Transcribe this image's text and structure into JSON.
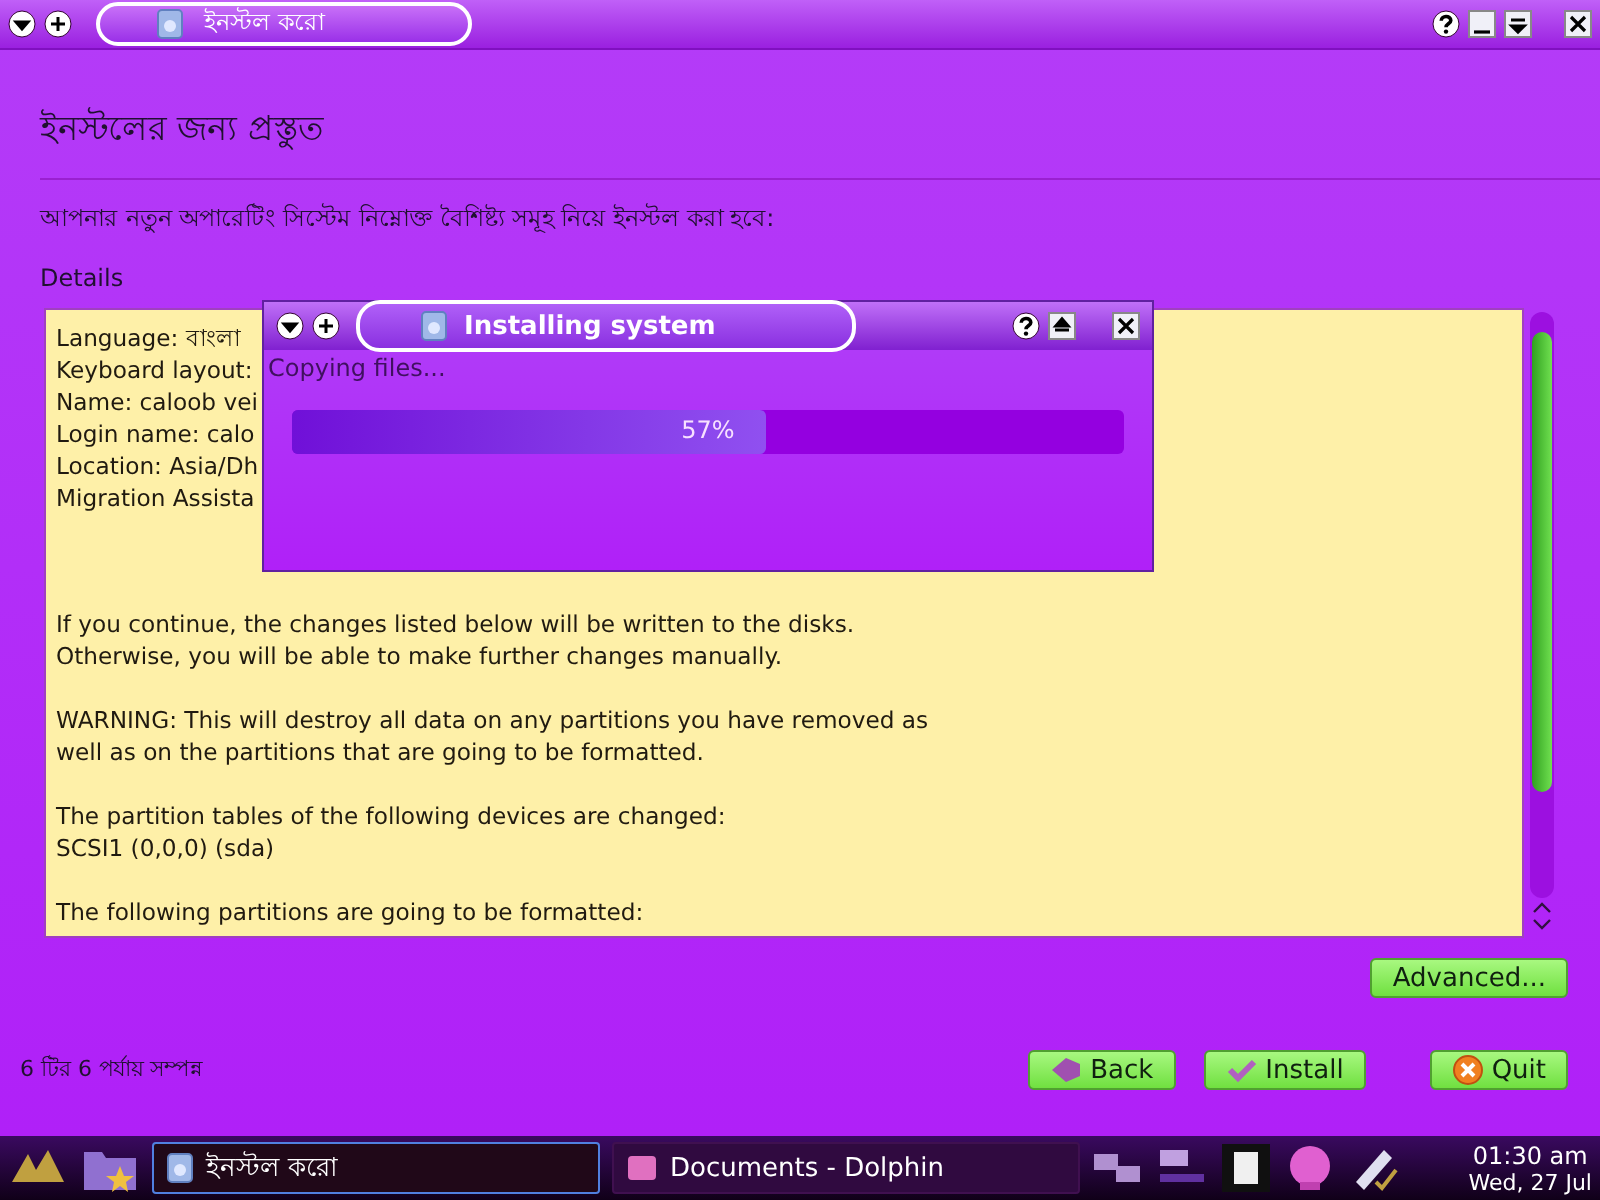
{
  "window": {
    "title": "ইনস্টল করো"
  },
  "heading": "ইনস্টলের জন্য প্রস্তুত",
  "intro": "আপনার নতুন অপারেটিং সিস্টেম নিম্নোক্ত বৈশিষ্ট্য সমূহ নিয়ে ইনস্টল করা হবে:",
  "details_label": "Details",
  "details": [
    {
      "lines": [
        "Language: বাংলা",
        "Keyboard layout:",
        "Name: caloob vei",
        "Login name: calo",
        "Location: Asia/Dh",
        "Migration Assista"
      ]
    },
    {
      "lines": [
        "If you continue, the changes listed below will be written to the disks.",
        "Otherwise, you will be able to make further changes manually."
      ]
    },
    {
      "lines": [
        "WARNING: This will destroy all data on any partitions you have removed as",
        "well as on the partitions that are going to be formatted."
      ]
    },
    {
      "lines": [
        "The partition tables of the following devices are changed:",
        "SCSI1 (0,0,0) (sda)"
      ]
    },
    {
      "lines": [
        "The following partitions are going to be formatted:"
      ]
    }
  ],
  "advanced_button": "Advanced...",
  "step_status": "6 টির 6 পর্যায় সম্পন্ন",
  "buttons": [
    {
      "kind": "back",
      "label": "Back"
    },
    {
      "kind": "install",
      "label": "Install"
    },
    {
      "kind": "quit",
      "label": "Quit"
    }
  ],
  "dialog": {
    "title": "Installing system",
    "message": "Copying files...",
    "progress": {
      "level": 0.57,
      "reading": "57%"
    }
  },
  "taskbar": {
    "tasks": [
      {
        "label": "ইনস্টল করো",
        "selected": true
      },
      {
        "label": "Documents - Dolphin",
        "selected": false
      }
    ],
    "clock": {
      "time": "01:30 am",
      "date": "Wed, 27 Jul"
    }
  }
}
